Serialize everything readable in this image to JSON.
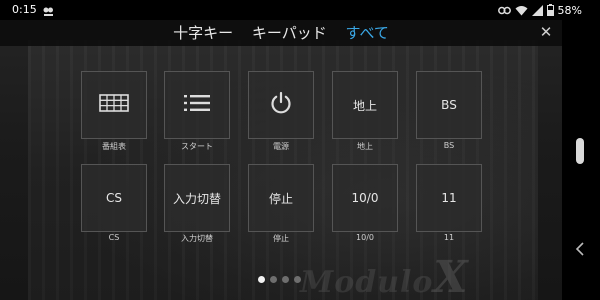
{
  "status_bar": {
    "time": "0:15",
    "battery": "58%"
  },
  "header": {
    "tabs": [
      {
        "label": "十字キー",
        "active": false
      },
      {
        "label": "キーパッド",
        "active": false
      },
      {
        "label": "すべて",
        "active": true
      }
    ],
    "close_symbol": "✕",
    "accent_color": "#3aa7e6"
  },
  "keys": [
    {
      "id": "guide",
      "icon": "grid-icon",
      "text": "",
      "label": "番組表"
    },
    {
      "id": "start",
      "icon": "list-icon",
      "text": "",
      "label": "スタート"
    },
    {
      "id": "power",
      "icon": "power-icon",
      "text": "",
      "label": "電源"
    },
    {
      "id": "terrestrial",
      "icon": "",
      "text": "地上",
      "label": "地上"
    },
    {
      "id": "bs",
      "icon": "",
      "text": "BS",
      "label": "BS"
    },
    {
      "id": "cs",
      "icon": "",
      "text": "CS",
      "label": "CS"
    },
    {
      "id": "input-switch",
      "icon": "",
      "text": "入力切替",
      "label": "入力切替"
    },
    {
      "id": "stop",
      "icon": "",
      "text": "停止",
      "label": "停止"
    },
    {
      "id": "ten-zero",
      "icon": "",
      "text": "10/0",
      "label": "10/0"
    },
    {
      "id": "eleven",
      "icon": "",
      "text": "11",
      "label": "11"
    }
  ],
  "pager": {
    "pages": 4,
    "current": 1
  },
  "background": {
    "wordmark": "Modulo",
    "wordmark_x": "X"
  }
}
